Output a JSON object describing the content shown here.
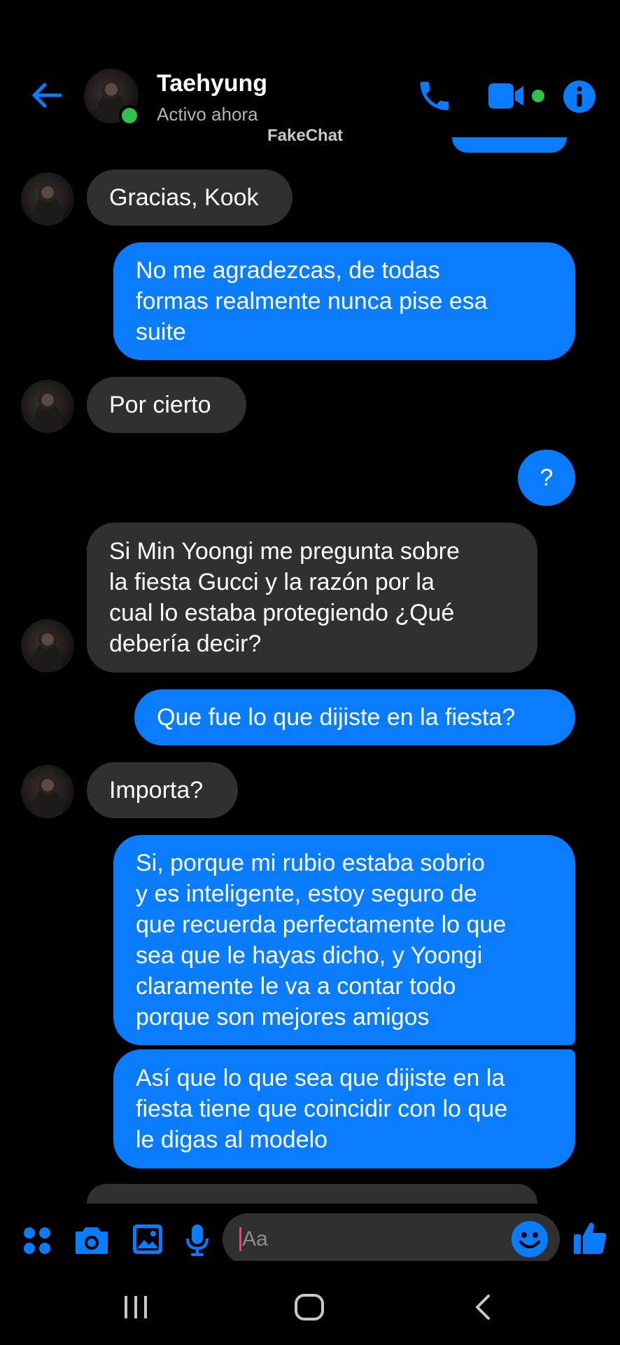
{
  "header": {
    "contact_name": "Taehyung",
    "status": "Activo ahora",
    "watermark": "FakeChat",
    "icons": [
      "back-arrow-icon",
      "phone-icon",
      "video-camera-icon",
      "info-icon"
    ],
    "accent_color": "#0a7cff"
  },
  "messages": [
    {
      "side": "in",
      "text": "Gracias, Kook"
    },
    {
      "side": "out",
      "text": "No me agradezcas, de todas\nformas realmente nunca pise esa\nsuite"
    },
    {
      "side": "in",
      "text": "Por cierto"
    },
    {
      "side": "out",
      "text": "?"
    },
    {
      "side": "in",
      "text": "Si Min Yoongi me pregunta sobre\nla fiesta Gucci y la razón por la\ncual lo estaba protegiendo ¿Qué\ndebería decir?"
    },
    {
      "side": "out",
      "text": "Que fue lo que dijiste en la fiesta?"
    },
    {
      "side": "in",
      "text": "Importa?"
    },
    {
      "side": "out",
      "text": "Si, porque mi rubio estaba sobrio\ny es inteligente, estoy seguro de\nque recuerda perfectamente lo que\nsea que le hayas dicho, y Yoongi\nclaramente le va a contar todo\nporque son mejores amigos"
    },
    {
      "side": "out",
      "text": "Así que lo que sea que dijiste en la\nfiesta tiene que coincidir con lo que\nle digas al modelo"
    }
  ],
  "composer": {
    "placeholder": "Aa",
    "icons": [
      "apps-icon",
      "camera-icon",
      "gallery-icon",
      "microphone-icon",
      "emoji-icon",
      "like-icon"
    ]
  },
  "navbar": {
    "icons": [
      "recent-apps-icon",
      "home-icon",
      "back-icon"
    ]
  }
}
